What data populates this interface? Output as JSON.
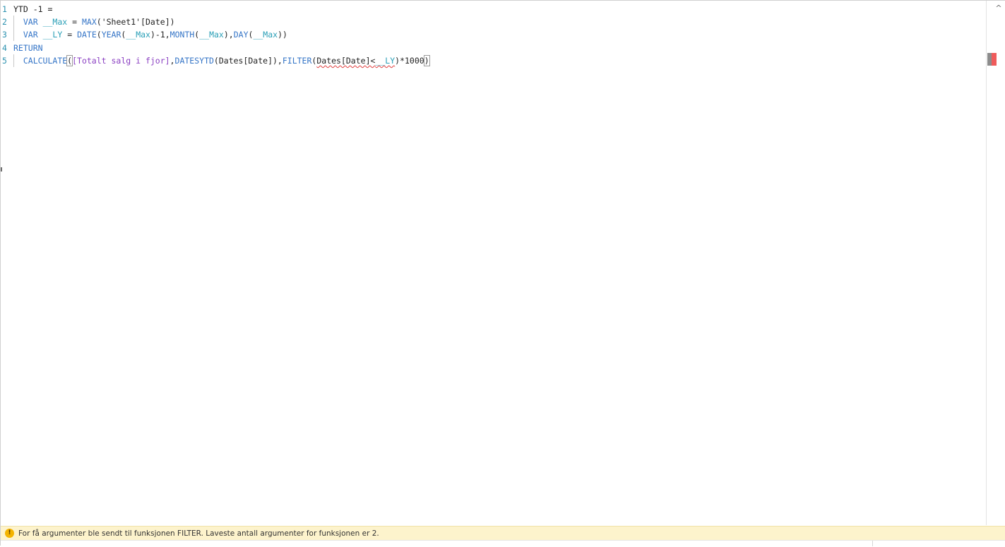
{
  "editor": {
    "lines": [
      {
        "number": "1",
        "tokens": [
          {
            "text": "YTD -1 =",
            "cls": "plain"
          }
        ]
      },
      {
        "number": "2",
        "tokens": [
          {
            "text": "  ",
            "cls": "plain"
          },
          {
            "text": "VAR",
            "cls": "kw"
          },
          {
            "text": " ",
            "cls": "plain"
          },
          {
            "text": "__Max",
            "cls": "var"
          },
          {
            "text": " = ",
            "cls": "plain"
          },
          {
            "text": "MAX",
            "cls": "fn"
          },
          {
            "text": "('Sheet1'[Date])",
            "cls": "plain"
          }
        ]
      },
      {
        "number": "3",
        "tokens": [
          {
            "text": "  ",
            "cls": "plain"
          },
          {
            "text": "VAR",
            "cls": "kw"
          },
          {
            "text": " ",
            "cls": "plain"
          },
          {
            "text": "__LY",
            "cls": "var"
          },
          {
            "text": " = ",
            "cls": "plain"
          },
          {
            "text": "DATE",
            "cls": "fn"
          },
          {
            "text": "(",
            "cls": "plain"
          },
          {
            "text": "YEAR",
            "cls": "fn"
          },
          {
            "text": "(",
            "cls": "plain"
          },
          {
            "text": "__Max",
            "cls": "var"
          },
          {
            "text": ")-1,",
            "cls": "plain"
          },
          {
            "text": "MONTH",
            "cls": "fn"
          },
          {
            "text": "(",
            "cls": "plain"
          },
          {
            "text": "__Max",
            "cls": "var"
          },
          {
            "text": "),",
            "cls": "plain"
          },
          {
            "text": "DAY",
            "cls": "fn"
          },
          {
            "text": "(",
            "cls": "plain"
          },
          {
            "text": "__Max",
            "cls": "var"
          },
          {
            "text": "))",
            "cls": "plain"
          }
        ]
      },
      {
        "number": "4",
        "tokens": [
          {
            "text": "RETURN",
            "cls": "kw"
          }
        ]
      },
      {
        "number": "5",
        "tokens": [
          {
            "text": "  ",
            "cls": "plain"
          },
          {
            "text": "CALCULATE",
            "cls": "fn"
          },
          {
            "text": "(",
            "cls": "plain cursor-bracket"
          },
          {
            "text": "[Totalt salg i fjor]",
            "cls": "meas"
          },
          {
            "text": ",",
            "cls": "plain"
          },
          {
            "text": "DATESYTD",
            "cls": "fn"
          },
          {
            "text": "(Dates[Date]),",
            "cls": "plain"
          },
          {
            "text": "FILTER",
            "cls": "fn"
          },
          {
            "text": "(",
            "cls": "plain"
          },
          {
            "text": "Dates[Date]<",
            "cls": "plain squiggle"
          },
          {
            "text": "__LY",
            "cls": "var squiggle"
          },
          {
            "text": ")*1000",
            "cls": "plain"
          },
          {
            "text": ")",
            "cls": "plain cursor-bracket"
          }
        ]
      }
    ]
  },
  "status": {
    "icon": "warning-icon",
    "message": "For få argumenter ble sendt til funksjonen FILTER. Laveste antall argumenter for funksjonen er 2."
  },
  "scrollbar": {
    "collapse_icon": "chevron-up-icon",
    "collapse_glyph": "^"
  },
  "colors": {
    "keyword": "#3575c7",
    "variable": "#2a9fb7",
    "measure": "#8a3fc2",
    "error": "#e03a3a",
    "warning_bg": "#fdf3cc",
    "line_number": "#2b91af"
  }
}
